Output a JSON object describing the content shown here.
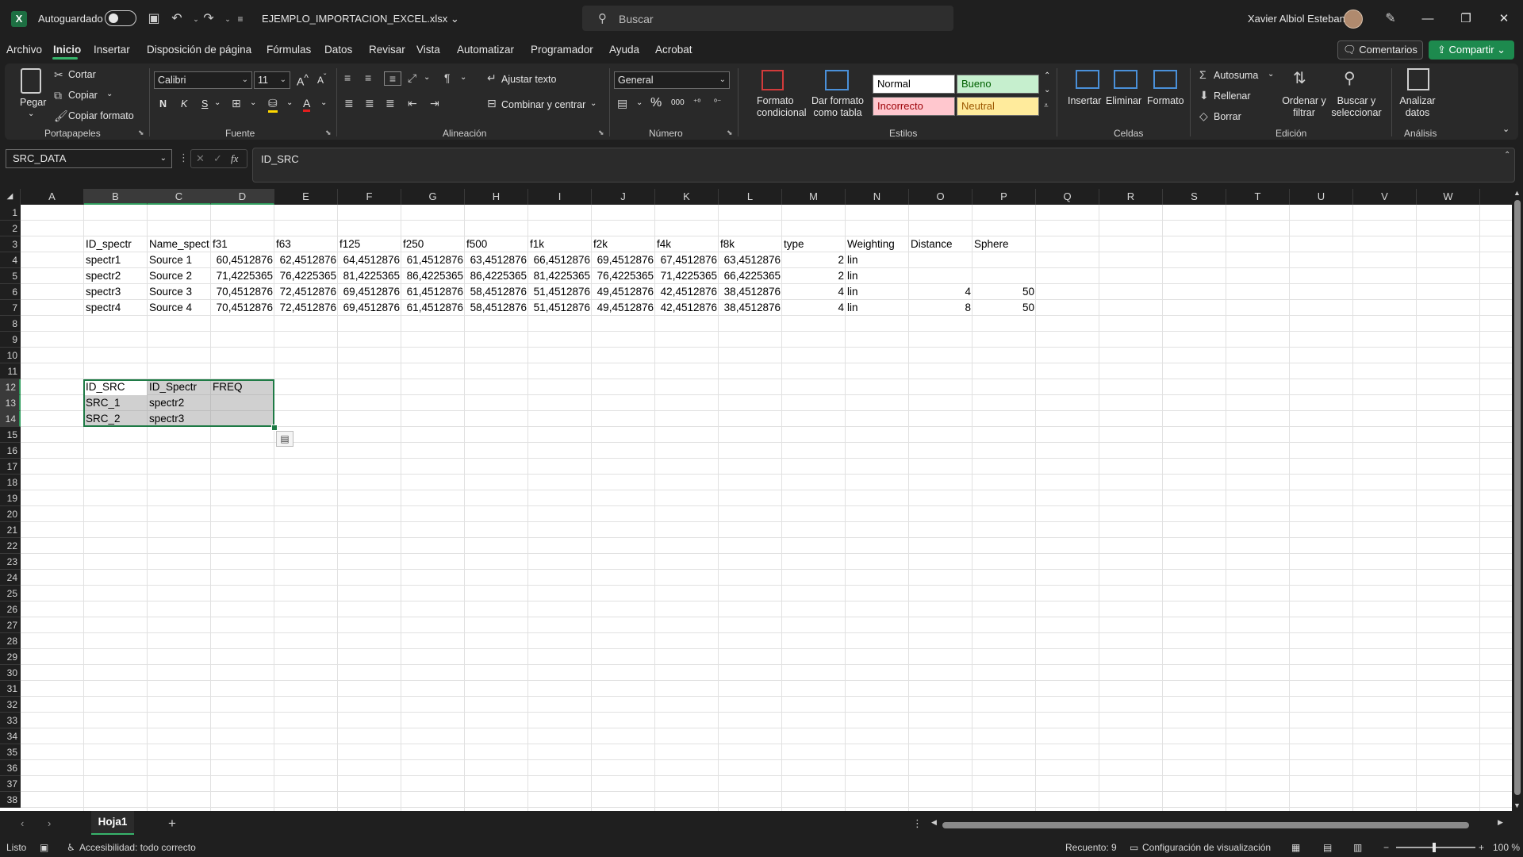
{
  "titlebar": {
    "autosave_label": "Autoguardado",
    "filename": "EJEMPLO_IMPORTACION_EXCEL.xlsx",
    "search_placeholder": "Buscar",
    "username": "Xavier Albiol Esteban"
  },
  "menu": {
    "items": [
      "Archivo",
      "Inicio",
      "Insertar",
      "Disposición de página",
      "Fórmulas",
      "Datos",
      "Revisar",
      "Vista",
      "Automatizar",
      "Programador",
      "Ayuda",
      "Acrobat"
    ],
    "active": "Inicio",
    "comments": "Comentarios",
    "share": "Compartir"
  },
  "ribbon": {
    "clipboard": {
      "paste": "Pegar",
      "cut": "Cortar",
      "copy": "Copiar",
      "format_painter": "Copiar formato",
      "label": "Portapapeles"
    },
    "font": {
      "name": "Calibri",
      "size": "11",
      "bold": "N",
      "italic": "K",
      "underline": "S",
      "label": "Fuente"
    },
    "alignment": {
      "wrap": "Ajustar texto",
      "merge": "Combinar y centrar",
      "label": "Alineación"
    },
    "number": {
      "format": "General",
      "label": "Número"
    },
    "styles": {
      "conditional": "Formato condicional",
      "as_table": "Dar formato como tabla",
      "normal": "Normal",
      "good": "Bueno",
      "bad": "Incorrecto",
      "neutral": "Neutral",
      "label": "Estilos"
    },
    "cells": {
      "insert": "Insertar",
      "delete": "Eliminar",
      "format": "Formato",
      "label": "Celdas"
    },
    "editing": {
      "autosum": "Autosuma",
      "fill": "Rellenar",
      "clear": "Borrar",
      "sort": "Ordenar y filtrar",
      "find": "Buscar y seleccionar",
      "label": "Edición"
    },
    "analysis": {
      "analyze": "Analizar datos",
      "label": "Análisis"
    },
    "colors": {
      "good_bg": "#c6efce",
      "good_fg": "#006100",
      "bad_bg": "#ffc7ce",
      "bad_fg": "#9c0006",
      "neutral_bg": "#ffeb9c",
      "neutral_fg": "#9c5700"
    }
  },
  "formula_bar": {
    "name_box": "SRC_DATA",
    "content": "ID_SRC"
  },
  "grid": {
    "columns": [
      "A",
      "B",
      "C",
      "D",
      "E",
      "F",
      "G",
      "H",
      "I",
      "J",
      "K",
      "L",
      "M",
      "N",
      "O",
      "P",
      "Q",
      "R",
      "S",
      "T",
      "U",
      "V",
      "W"
    ],
    "rows": [
      "1",
      "2",
      "3",
      "4",
      "5",
      "6",
      "7",
      "8",
      "9",
      "10",
      "11",
      "12",
      "13",
      "14",
      "15",
      "16",
      "17",
      "18",
      "19",
      "20",
      "21",
      "22",
      "23",
      "24",
      "25",
      "26",
      "27",
      "28",
      "29",
      "30",
      "31",
      "32",
      "33",
      "34",
      "35",
      "36",
      "37",
      "38"
    ],
    "header_row": [
      "ID_spectr",
      "Name_spect",
      "f31",
      "f63",
      "f125",
      "f250",
      "f500",
      "f1k",
      "f2k",
      "f4k",
      "f8k",
      "type",
      "Weighting",
      "Distance",
      "Sphere"
    ],
    "data_rows": [
      [
        "spectr1",
        "Source 1",
        "60,4512876",
        "62,4512876",
        "64,4512876",
        "61,4512876",
        "63,4512876",
        "66,4512876",
        "69,4512876",
        "67,4512876",
        "63,4512876",
        "2",
        "lin",
        "",
        ""
      ],
      [
        "spectr2",
        "Source 2",
        "71,4225365",
        "76,4225365",
        "81,4225365",
        "86,4225365",
        "86,4225365",
        "81,4225365",
        "76,4225365",
        "71,4225365",
        "66,4225365",
        "2",
        "lin",
        "",
        ""
      ],
      [
        "spectr3",
        "Source 3",
        "70,4512876",
        "72,4512876",
        "69,4512876",
        "61,4512876",
        "58,4512876",
        "51,4512876",
        "49,4512876",
        "42,4512876",
        "38,4512876",
        "4",
        "lin",
        "4",
        "50"
      ],
      [
        "spectr4",
        "Source 4",
        "70,4512876",
        "72,4512876",
        "69,4512876",
        "61,4512876",
        "58,4512876",
        "51,4512876",
        "49,4512876",
        "42,4512876",
        "38,4512876",
        "4",
        "lin",
        "8",
        "50"
      ]
    ],
    "src_table": [
      [
        "ID_SRC",
        "ID_Spectr",
        "FREQ"
      ],
      [
        "SRC_1",
        "spectr2",
        ""
      ],
      [
        "SRC_2",
        "spectr3",
        ""
      ]
    ]
  },
  "sheets": {
    "active": "Hoja1"
  },
  "status": {
    "ready": "Listo",
    "accessibility": "Accesibilidad: todo correcto",
    "count": "Recuento: 9",
    "view_settings": "Configuración de visualización",
    "zoom": "100 %"
  }
}
